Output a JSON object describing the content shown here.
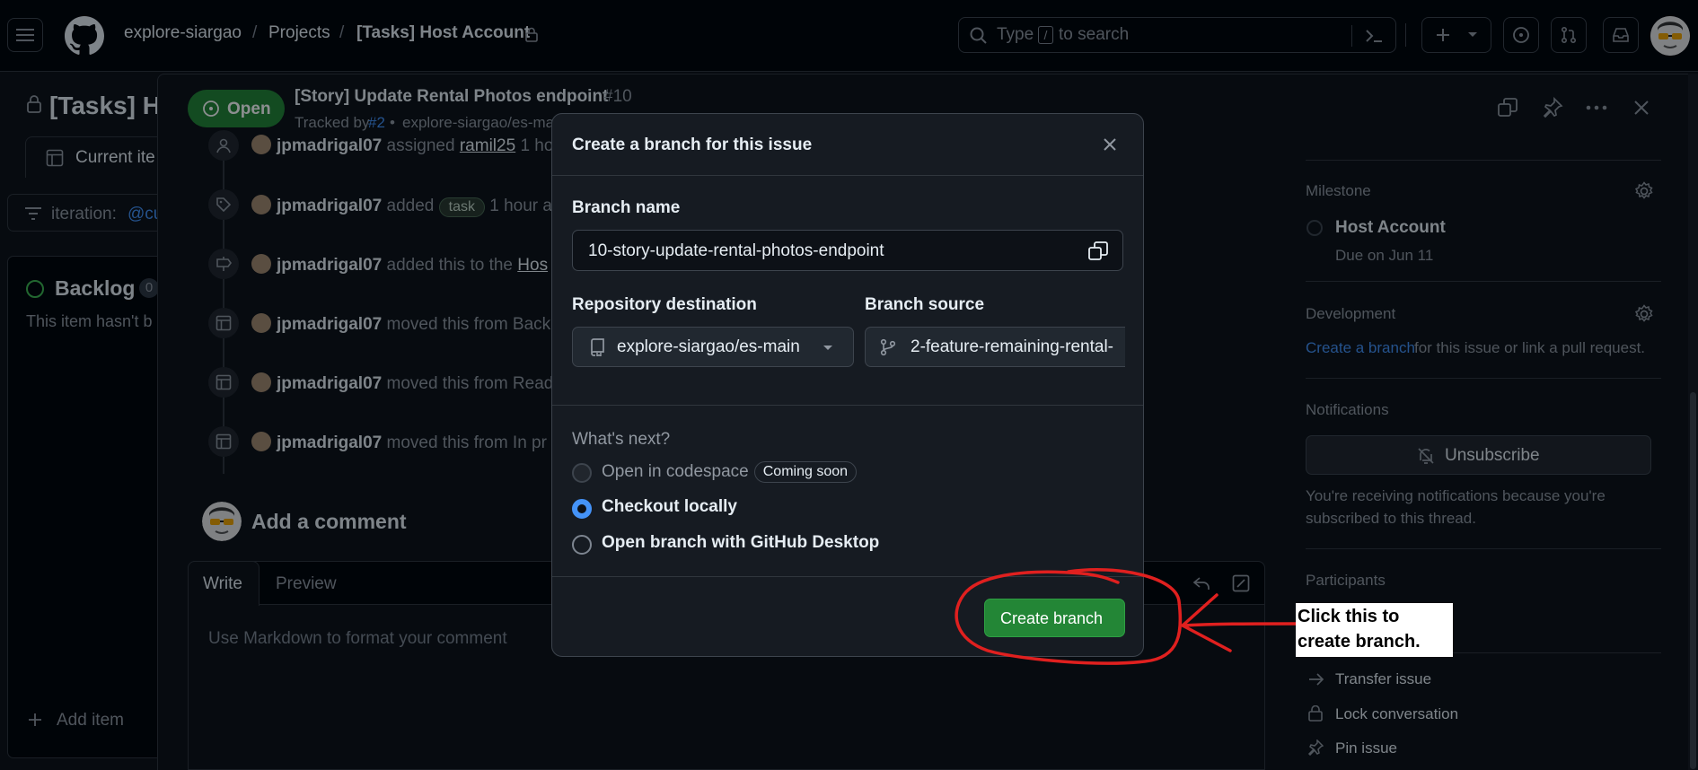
{
  "header": {
    "breadcrumbs": [
      "explore-siargao",
      "Projects",
      "[Tasks] Host Account"
    ],
    "separator": "/",
    "search_placeholder_prefix": "Type",
    "search_key": "/",
    "search_placeholder_suffix": "to search"
  },
  "project": {
    "title": "[Tasks] Ho",
    "view_tab": "Current ite",
    "filter_prefix": "iteration:",
    "filter_value": "@cur",
    "column_title": "Backlog",
    "column_count": "0",
    "column_empty": "This item hasn't b",
    "add_item": "Add item"
  },
  "issue": {
    "state": "Open",
    "title": "[Story] Update Rental Photos endpoint",
    "number": "#10",
    "tracked_prefix": "Tracked by",
    "tracked_ref": "#2",
    "tracked_repo": "explore-siargao/es-mai"
  },
  "timeline": [
    {
      "actor": "jpmadrigal07",
      "text": "assigned",
      "extra": "ramil25",
      "tail": "1 ho"
    },
    {
      "actor": "jpmadrigal07",
      "text": "added",
      "label": "task",
      "tail": "1 hour a"
    },
    {
      "actor": "jpmadrigal07",
      "text": "added this to the",
      "extra": "Hos"
    },
    {
      "actor": "jpmadrigal07",
      "text": "moved this from Back"
    },
    {
      "actor": "jpmadrigal07",
      "text": "moved this from Read"
    },
    {
      "actor": "jpmadrigal07",
      "text": "moved this from In pr"
    }
  ],
  "comment": {
    "heading": "Add a comment",
    "tab_write": "Write",
    "tab_preview": "Preview",
    "placeholder": "Use Markdown to format your comment"
  },
  "sidebar": {
    "milestone_heading": "Milestone",
    "milestone_name": "Host Account",
    "milestone_due": "Due on Jun 11",
    "development_heading": "Development",
    "development_link": "Create a branch",
    "development_text": "for this issue or link a pull request.",
    "notifications_heading": "Notifications",
    "unsubscribe_label": "Unsubscribe",
    "notifications_note_1": "You're receiving notifications because you're",
    "notifications_note_2": "subscribed to this thread.",
    "participants_heading": "Participants",
    "transfer_issue": "Transfer issue",
    "lock_conversation": "Lock conversation",
    "pin_issue": "Pin issue"
  },
  "dialog": {
    "title": "Create a branch for this issue",
    "branch_name_label": "Branch name",
    "branch_name_value": "10-story-update-rental-photos-endpoint",
    "repo_label": "Repository destination",
    "repo_value": "explore-siargao/es-main",
    "source_label": "Branch source",
    "source_value": "2-feature-remaining-rental-",
    "whats_next": "What's next?",
    "option_codespace": "Open in codespace",
    "option_codespace_badge": "Coming soon",
    "option_checkout": "Checkout locally",
    "option_desktop": "Open branch with GitHub Desktop",
    "selected_option": "Checkout locally",
    "create_button": "Create branch"
  },
  "annotation": {
    "line_1": "Click this to",
    "line_2": "create branch.",
    "color": "#e0201f"
  },
  "colors": {
    "accent_green": "#238636",
    "link_blue": "#4493f8",
    "open_badge": "#238636"
  }
}
